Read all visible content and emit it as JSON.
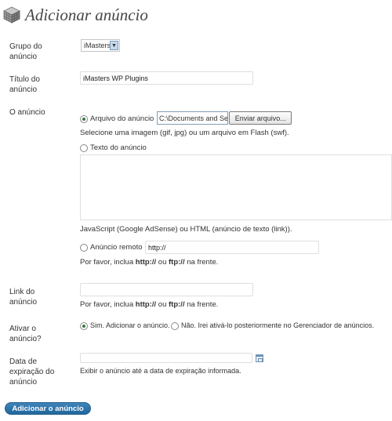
{
  "page": {
    "title": "Adicionar anúncio",
    "logo_icon": "cube-grid-icon"
  },
  "group": {
    "label": "Grupo do anúncio",
    "selected": "iMasters"
  },
  "title_field": {
    "label": "Título do anúncio",
    "value": "iMasters WP Plugins"
  },
  "ad": {
    "label": "O anúncio",
    "file": {
      "option_label": "Arquivo do anúncio",
      "path_value": "C:\\Documents and Se",
      "browse_label": "Enviar arquivo...",
      "help": "Selecione uma imagem (gif, jpg) ou um arquivo em Flash (swf)."
    },
    "text": {
      "option_label": "Texto do anúncio",
      "help": "JavaScript (Google AdSense) ou HTML (anúncio de texto (link))."
    },
    "remote": {
      "option_label": "Anúncio remoto",
      "value": "http://",
      "help_prefix": "Por favor, inclua ",
      "help_http": "http://",
      "help_or": " ou ",
      "help_ftp": "ftp://",
      "help_suffix": " na frente."
    }
  },
  "link": {
    "label": "Link do anúncio",
    "value": "",
    "help_prefix": "Por favor, inclua ",
    "help_http": "http://",
    "help_or": " ou ",
    "help_ftp": "ftp://",
    "help_suffix": " na frente."
  },
  "activate": {
    "label": "Ativar o anúncio?",
    "yes_label": "Sim. Adicionar o anúncio.",
    "no_label": "Não. Irei ativá-lo posteriormente no Gerenciador de anúncios."
  },
  "expiry": {
    "label": "Data de expiração do anúncio",
    "value": "",
    "help": "Exibir o anúncio até a data de expiração informada.",
    "calendar_icon": "calendar-icon"
  },
  "submit": {
    "label": "Adicionar o anúncio"
  }
}
